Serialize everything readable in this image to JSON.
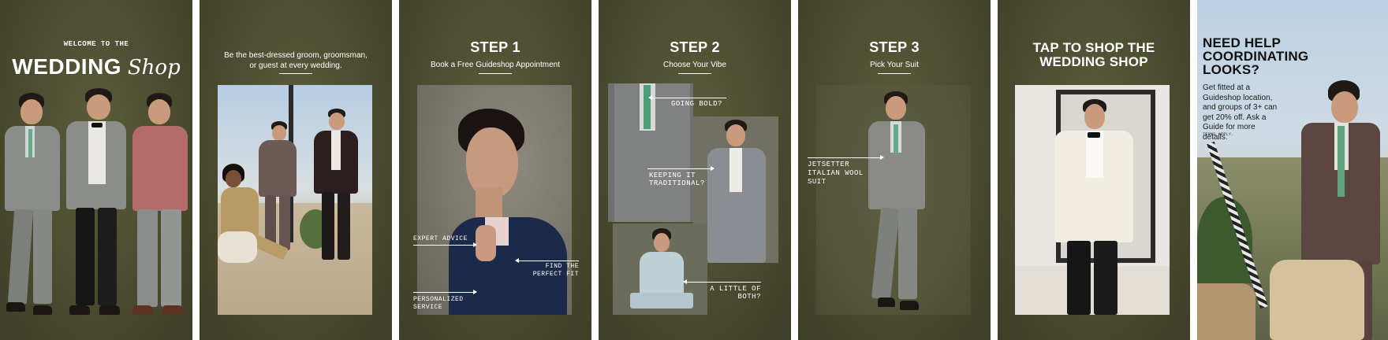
{
  "colors": {
    "panel_bg": "#4a4b30",
    "text": "#ffffff",
    "sky": "#b9cde0"
  },
  "panel1": {
    "kicker": "WELCOME TO THE",
    "title_bold": "WEDDING",
    "title_script": "Shop"
  },
  "panel2": {
    "tagline": "Be the best-dressed groom, groomsman, or guest at every wedding."
  },
  "panel3": {
    "title": "STEP 1",
    "subtitle": "Book a Free Guideshop Appointment",
    "callout_expert": "EXPERT ADVICE",
    "callout_fit_line1": "FIND THE",
    "callout_fit_line2": "PERFECT FIT",
    "callout_service_line1": "PERSONALIZED",
    "callout_service_line2": "SERVICE"
  },
  "panel4": {
    "title": "STEP 2",
    "subtitle": "Choose Your Vibe",
    "callout_bold": "GOING BOLD?",
    "callout_trad_line1": "KEEPING IT",
    "callout_trad_line2": "TRADITIONAL?",
    "callout_both_line1": "A LITTLE OF",
    "callout_both_line2": "BOTH?"
  },
  "panel5": {
    "title": "STEP 3",
    "subtitle": "Pick Your Suit",
    "callout_line1": "JETSETTER",
    "callout_line2": "ITALIAN WOOL",
    "callout_line3": "SUIT"
  },
  "panel6": {
    "title_line1": "TAP TO SHOP THE",
    "title_line2": "WEDDING SHOP"
  },
  "panel7": {
    "title_line1": "NEED HELP",
    "title_line2": "COORDINATING",
    "title_line3": "LOOKS?",
    "body": "Get fitted at a Guideshop location, and groups of 3+ can get 20% off. Ask a Guide for  more details.",
    "fine_print": "TERMS APPLY."
  }
}
